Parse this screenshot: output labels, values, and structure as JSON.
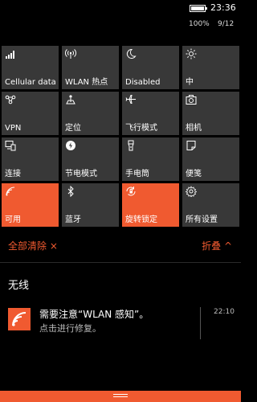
{
  "status": {
    "time": "23:36",
    "battery_percent": "100%",
    "date": "9/12",
    "battery_level": 1.0
  },
  "tiles": [
    {
      "label": "Cellular data",
      "icon": "signal-bars-icon",
      "active": false
    },
    {
      "label": "WLAN 热点",
      "icon": "wifi-hotspot-icon",
      "active": false
    },
    {
      "label": "Disabled",
      "icon": "moon-icon",
      "active": false
    },
    {
      "label": "中",
      "icon": "brightness-icon",
      "active": false
    },
    {
      "label": "VPN",
      "icon": "vpn-icon",
      "active": false
    },
    {
      "label": "定位",
      "icon": "location-icon",
      "active": false
    },
    {
      "label": "飞行模式",
      "icon": "airplane-icon",
      "active": false
    },
    {
      "label": "相机",
      "icon": "camera-icon",
      "active": false
    },
    {
      "label": "连接",
      "icon": "connect-icon",
      "active": false
    },
    {
      "label": "节电模式",
      "icon": "battery-saver-icon",
      "active": false
    },
    {
      "label": "手电筒",
      "icon": "flashlight-icon",
      "active": false
    },
    {
      "label": "便笺",
      "icon": "note-icon",
      "active": false
    },
    {
      "label": "可用",
      "icon": "wifi-icon",
      "active": true
    },
    {
      "label": "蓝牙",
      "icon": "bluetooth-icon",
      "active": false
    },
    {
      "label": "旋转锁定",
      "icon": "rotation-lock-icon",
      "active": true
    },
    {
      "label": "所有设置",
      "icon": "gear-icon",
      "active": false
    }
  ],
  "actions": {
    "clear_all": "全部清除 ×",
    "collapse": "折叠 ^"
  },
  "group": {
    "title": "无线"
  },
  "notification": {
    "title": "需要注意“WLAN 感知”。",
    "body": "点击进行修复。",
    "time": "22:10",
    "icon": "wifi-icon"
  },
  "colors": {
    "accent": "#f05a30",
    "tile": "#383838",
    "background": "#000000"
  }
}
